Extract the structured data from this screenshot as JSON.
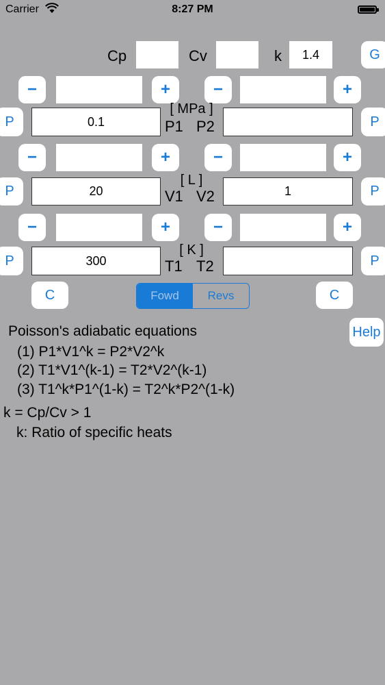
{
  "status_bar": {
    "carrier": "Carrier",
    "time": "8:27 PM"
  },
  "header": {
    "cp_label": "Cp",
    "cv_label": "Cv",
    "k_label": "k",
    "cp_value": "",
    "cv_value": "",
    "k_value": "1.4",
    "g_button": "G"
  },
  "stepper": {
    "minus": "−",
    "plus": "+"
  },
  "pressure": {
    "unit": "[ MPa ]",
    "left_label": "P1",
    "right_label": "P2",
    "left_value": "0.1",
    "right_value": "",
    "p_button": "P"
  },
  "volume": {
    "unit": "[ L ]",
    "left_label": "V1",
    "right_label": "V2",
    "left_value": "20",
    "right_value": "1",
    "p_button": "P"
  },
  "temperature": {
    "unit": "[ K ]",
    "left_label": "T1",
    "right_label": "T2",
    "left_value": "300",
    "right_value": "",
    "p_button": "P"
  },
  "clear_button": "C",
  "mode": {
    "forward": "Fowd",
    "reverse": "Revs",
    "selected": "Fowd"
  },
  "help_button": "Help",
  "info": {
    "title": "Poisson's adiabatic equations",
    "eq1": "(1) P1*V1^k = P2*V2^k",
    "eq2": "(2) T1*V1^(k-1) = T2*V2^(k-1)",
    "eq3": "(3) T1^k*P1^(1-k) = T2^k*P2^(1-k)",
    "k_def": "k = Cp/Cv > 1",
    "k_desc": "k: Ratio of specific heats"
  },
  "colors": {
    "background": "#a9a9ab",
    "accent": "#1a7bd6"
  }
}
